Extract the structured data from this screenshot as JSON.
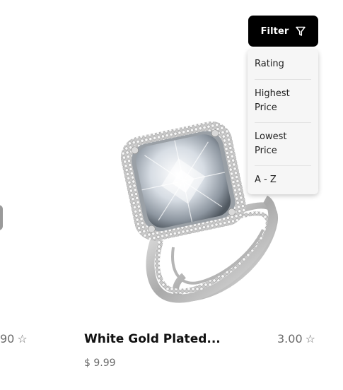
{
  "filter": {
    "label": "Filter",
    "icon": "filter-funnel-icon",
    "options": [
      "Rating",
      "Highest Price",
      "Lowest Price",
      "A - Z"
    ]
  },
  "products": {
    "left_partial": {
      "rating": "90"
    },
    "main": {
      "name": "White Gold Plated...",
      "price": "$ 9.99",
      "rating": "3.00",
      "image": "silver-diamond-ring-image"
    }
  },
  "colors": {
    "button_bg": "#000000",
    "button_text": "#ffffff",
    "dropdown_bg": "#f6f6f6",
    "muted_text": "#6a6a6a"
  }
}
